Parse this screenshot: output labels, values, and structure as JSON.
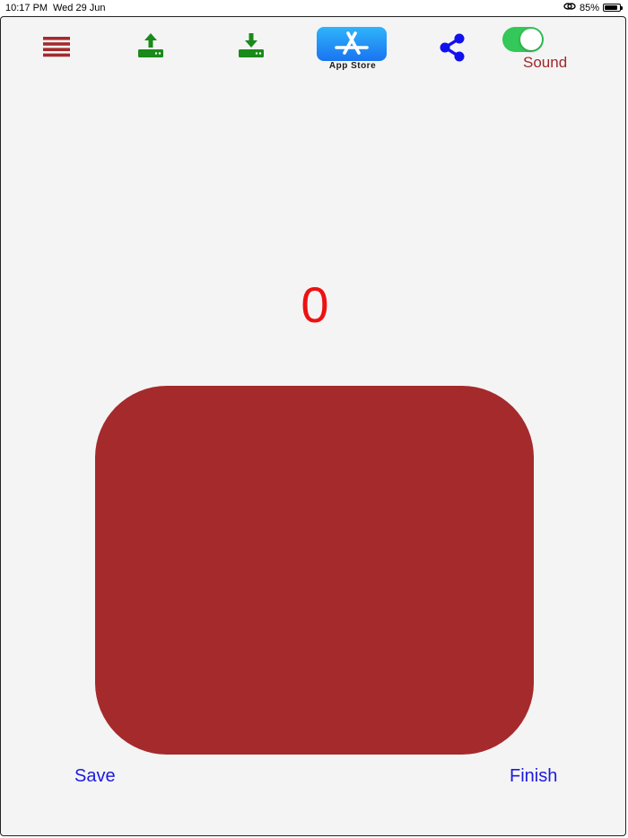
{
  "status_bar": {
    "time": "10:17 PM",
    "date": "Wed 29 Jun",
    "battery": "85%",
    "battery_level": 0.85
  },
  "toolbar": {
    "menu_icon": "hamburger-menu-icon",
    "upload_icon": "upload-icon",
    "download_icon": "download-icon",
    "app_store_label": "App Store",
    "share_icon": "share-icon",
    "sound_label": "Sound",
    "sound_enabled": true
  },
  "counter": {
    "value": "0"
  },
  "actions": {
    "save_label": "Save",
    "finish_label": "Finish"
  },
  "colors": {
    "menu": "#a52a2c",
    "upload_download": "#1a8a1a",
    "share": "#1111ee",
    "counter": "#ee1111",
    "pad": "#a52a2c",
    "links": "#1b1be0",
    "toggle_on": "#34c759"
  }
}
